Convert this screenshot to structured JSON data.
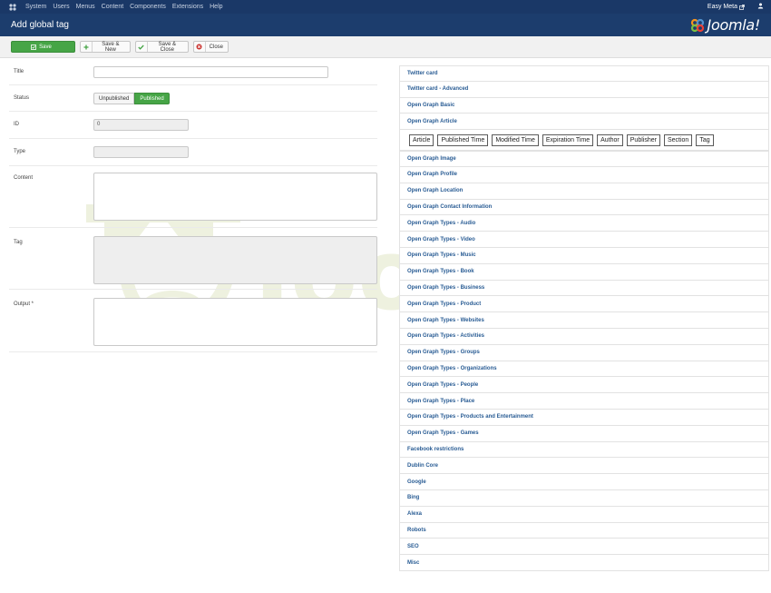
{
  "topnav": {
    "items": [
      "System",
      "Users",
      "Menus",
      "Content",
      "Components",
      "Extensions",
      "Help"
    ],
    "site_name": "Easy Meta"
  },
  "header": {
    "title": "Add global tag",
    "brand": "Joomla!"
  },
  "toolbar": {
    "save": "Save",
    "save_new": "Save & New",
    "save_close": "Save & Close",
    "close": "Close"
  },
  "watermark": {
    "text": "Joomla.bid"
  },
  "form": {
    "title_label": "Title",
    "title_value": "",
    "status_label": "Status",
    "status_options": [
      "Unpublished",
      "Published"
    ],
    "status_selected": "Published",
    "id_label": "ID",
    "id_value": "0",
    "type_label": "Type",
    "type_value": "",
    "content_label": "Content",
    "tag_label": "Tag",
    "output_label": "Output *"
  },
  "accordion": {
    "before": [
      "Twitter card",
      "Twitter card - Advanced",
      "Open Graph Basic",
      "Open Graph Article"
    ],
    "expanded_buttons": [
      "Article",
      "Published Time",
      "Modified Time",
      "Expiration Time",
      "Author",
      "Publisher",
      "Section",
      "Tag"
    ],
    "after": [
      "Open Graph Image",
      "Open Graph Profile",
      "Open Graph Location",
      "Open Graph Contact Information",
      "Open Graph Types - Audio",
      "Open Graph Types - Video",
      "Open Graph Types - Music",
      "Open Graph Types - Book",
      "Open Graph Types - Business",
      "Open Graph Types - Product",
      "Open Graph Types - Websites",
      "Open Graph Types - Activities",
      "Open Graph Types - Groups",
      "Open Graph Types - Organizations",
      "Open Graph Types - People",
      "Open Graph Types - Place",
      "Open Graph Types - Products and Entertainment",
      "Open Graph Types - Games",
      "Facebook restrictions",
      "Dublin Core",
      "Google",
      "Bing",
      "Alexa",
      "Robots",
      "SEO",
      "Misc"
    ]
  },
  "colors": {
    "nav_bg": "#1a3867",
    "header_bg": "#1c3d6d",
    "save_green": "#46a546",
    "link_blue": "#295c94",
    "watermark": "#f1f3e5"
  }
}
